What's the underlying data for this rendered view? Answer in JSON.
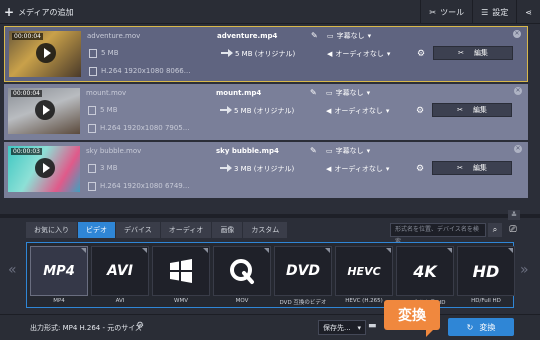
{
  "toolbar": {
    "add_media_label": "メディアの追加",
    "tools_label": "ツール",
    "settings_label": "設定"
  },
  "files": [
    {
      "duration": "00:00:04",
      "source_name": "adventure.mov",
      "source_size": "5 MB",
      "source_meta": "H.264 1920x1080 8066...",
      "output_name": "adventure.mp4",
      "output_size": "5 MB (オリジナル)",
      "subtitles": "字幕なし",
      "audio": "オーディオなし",
      "edit_label": "編集"
    },
    {
      "duration": "00:00:04",
      "source_name": "mount.mov",
      "source_size": "5 MB",
      "source_meta": "H.264 1920x1080 7905...",
      "output_name": "mount.mp4",
      "output_size": "5 MB (オリジナル)",
      "subtitles": "字幕なし",
      "audio": "オーディオなし",
      "edit_label": "編集"
    },
    {
      "duration": "00:00:03",
      "source_name": "sky bubble.mov",
      "source_size": "3 MB",
      "source_meta": "H.264 1920x1080 6749...",
      "output_name": "sky bubble.mp4",
      "output_size": "3 MB (オリジナル)",
      "subtitles": "字幕なし",
      "audio": "オーディオなし",
      "edit_label": "編集"
    }
  ],
  "tabs": [
    "お気に入り",
    "ビデオ",
    "デバイス",
    "オーディオ",
    "画像",
    "カスタム"
  ],
  "active_tab": "ビデオ",
  "search": {
    "placeholder": "形式名を位置、デバイス名を検索..."
  },
  "formats": [
    {
      "logo": "MP4",
      "label": "MP4"
    },
    {
      "logo": "AVI",
      "label": "AVI"
    },
    {
      "logo": "WMV",
      "label": "WMV"
    },
    {
      "logo": "MOV",
      "label": "MOV"
    },
    {
      "logo": "DVD",
      "label": "DVD 互換のビデオ"
    },
    {
      "logo": "HEVC",
      "label": "HEVC (H.265)"
    },
    {
      "logo": "4K",
      "label": "4K ウルトラ HD"
    },
    {
      "logo": "HD",
      "label": "HD/Full HD"
    }
  ],
  "bottom": {
    "output_format": "出力形式: MP4 H.264 - 元のサイズ",
    "save_label": "保存先...",
    "convert_label": "変換",
    "callout_label": "変換"
  },
  "colors": {
    "accent": "#2f86d6",
    "callout": "#f0883e",
    "selected_border": "#d8b84a"
  }
}
